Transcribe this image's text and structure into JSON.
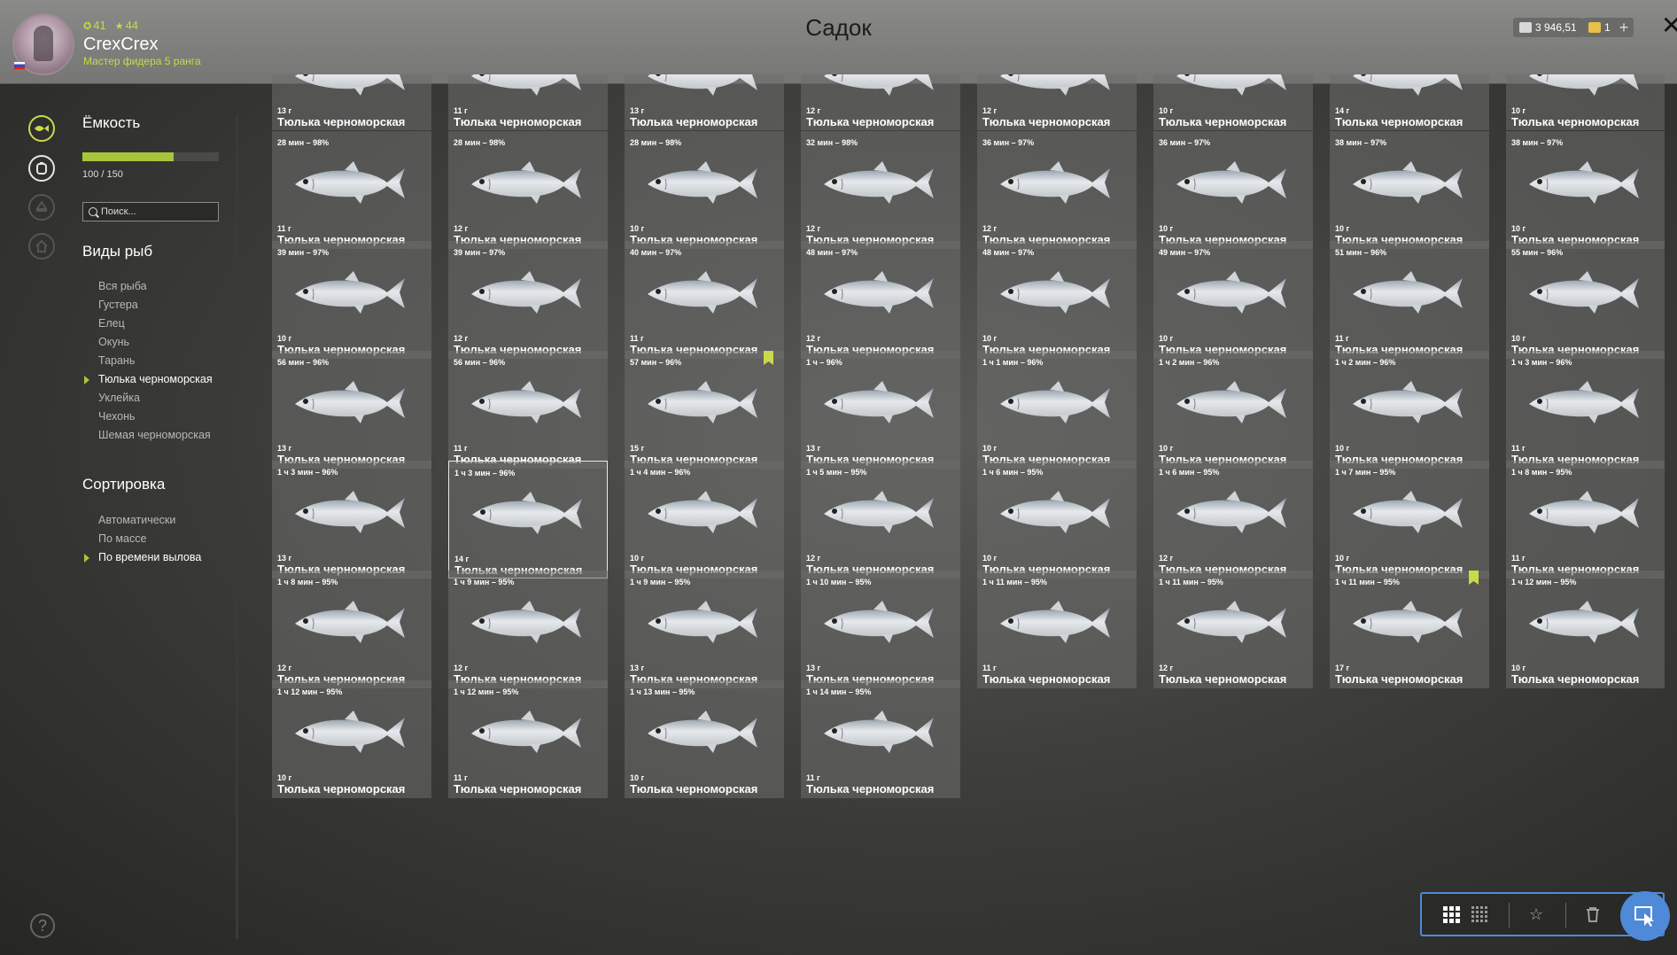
{
  "header": {
    "title": "Садок",
    "level": "41",
    "stars": "44",
    "username": "CrexCrex",
    "rank": "Мастер фидера 5 ранга",
    "silver": "3 946,51",
    "gold": "1",
    "plus_label": "+",
    "close_label": "✕"
  },
  "sidebar": {
    "capacity_title": "Ёмкость",
    "capacity_value": 100,
    "capacity_max": 150,
    "capacity_text": "100 / 150",
    "search_placeholder": "Поиск...",
    "species_title": "Виды рыб",
    "species": [
      "Вся рыба",
      "Густера",
      "Елец",
      "Окунь",
      "Тарань",
      "Тюлька черноморская",
      "Уклейка",
      "Чехонь",
      "Шемая черноморская"
    ],
    "species_active": 5,
    "sort_title": "Сортировка",
    "sort_options": [
      "Автоматически",
      "По массе",
      "По времени вылова"
    ],
    "sort_active": 2
  },
  "fish_name": "Тюлька черноморская",
  "rows": [
    [
      {
        "t": "",
        "w": "13 г"
      },
      {
        "t": "",
        "w": "11 г"
      },
      {
        "t": "",
        "w": "13 г"
      },
      {
        "t": "",
        "w": "12 г"
      },
      {
        "t": "",
        "w": "12 г"
      },
      {
        "t": "",
        "w": "10 г"
      },
      {
        "t": "",
        "w": "14 г"
      },
      {
        "t": "",
        "w": "10 г"
      }
    ],
    [
      {
        "t": "28 мин – 98%",
        "w": "11 г"
      },
      {
        "t": "28 мин – 98%",
        "w": "12 г"
      },
      {
        "t": "28 мин – 98%",
        "w": "10 г"
      },
      {
        "t": "32 мин – 98%",
        "w": "12 г"
      },
      {
        "t": "36 мин – 97%",
        "w": "12 г"
      },
      {
        "t": "36 мин – 97%",
        "w": "10 г"
      },
      {
        "t": "38 мин – 97%",
        "w": "10 г"
      },
      {
        "t": "38 мин – 97%",
        "w": "10 г"
      }
    ],
    [
      {
        "t": "39 мин – 97%",
        "w": "10 г"
      },
      {
        "t": "39 мин – 97%",
        "w": "12 г"
      },
      {
        "t": "40 мин – 97%",
        "w": "11 г"
      },
      {
        "t": "48 мин – 97%",
        "w": "12 г"
      },
      {
        "t": "48 мин – 97%",
        "w": "10 г"
      },
      {
        "t": "49 мин – 97%",
        "w": "10 г"
      },
      {
        "t": "51 мин – 96%",
        "w": "11 г"
      },
      {
        "t": "55 мин – 96%",
        "w": "10 г"
      }
    ],
    [
      {
        "t": "56 мин – 96%",
        "w": "13 г"
      },
      {
        "t": "56 мин – 96%",
        "w": "11 г"
      },
      {
        "t": "57 мин – 96%",
        "w": "15 г",
        "mark": true
      },
      {
        "t": "1 ч – 96%",
        "w": "13 г"
      },
      {
        "t": "1 ч 1 мин – 96%",
        "w": "10 г"
      },
      {
        "t": "1 ч 2 мин – 96%",
        "w": "10 г"
      },
      {
        "t": "1 ч 2 мин – 96%",
        "w": "10 г"
      },
      {
        "t": "1 ч 3 мин – 96%",
        "w": "11 г"
      }
    ],
    [
      {
        "t": "1 ч 3 мин – 96%",
        "w": "13 г"
      },
      {
        "t": "1 ч 3 мин – 96%",
        "w": "14 г",
        "selected": true
      },
      {
        "t": "1 ч 4 мин – 96%",
        "w": "10 г"
      },
      {
        "t": "1 ч 5 мин – 95%",
        "w": "12 г"
      },
      {
        "t": "1 ч 6 мин – 95%",
        "w": "10 г"
      },
      {
        "t": "1 ч 6 мин – 95%",
        "w": "12 г"
      },
      {
        "t": "1 ч 7 мин – 95%",
        "w": "10 г"
      },
      {
        "t": "1 ч 8 мин – 95%",
        "w": "11 г"
      }
    ],
    [
      {
        "t": "1 ч 8 мин – 95%",
        "w": "12 г"
      },
      {
        "t": "1 ч 9 мин – 95%",
        "w": "12 г"
      },
      {
        "t": "1 ч 9 мин – 95%",
        "w": "13 г"
      },
      {
        "t": "1 ч 10 мин – 95%",
        "w": "13 г"
      },
      {
        "t": "1 ч 11 мин – 95%",
        "w": "11 г"
      },
      {
        "t": "1 ч 11 мин – 95%",
        "w": "12 г"
      },
      {
        "t": "1 ч 11 мин – 95%",
        "w": "17 г",
        "mark": true
      },
      {
        "t": "1 ч 12 мин – 95%",
        "w": "10 г"
      }
    ],
    [
      {
        "t": "1 ч 12 мин – 95%",
        "w": "10 г"
      },
      {
        "t": "1 ч 12 мин – 95%",
        "w": "11 г"
      },
      {
        "t": "1 ч 13 мин – 95%",
        "w": "10 г"
      },
      {
        "t": "1 ч 14 мин – 95%",
        "w": "11 г"
      }
    ]
  ],
  "colors": {
    "accent": "#a8c43a",
    "toolbar_border": "#4f8ad8"
  },
  "icons": {
    "rail": [
      "fish-icon",
      "keepnet-icon",
      "boat-icon",
      "home-icon"
    ],
    "help": "?"
  }
}
